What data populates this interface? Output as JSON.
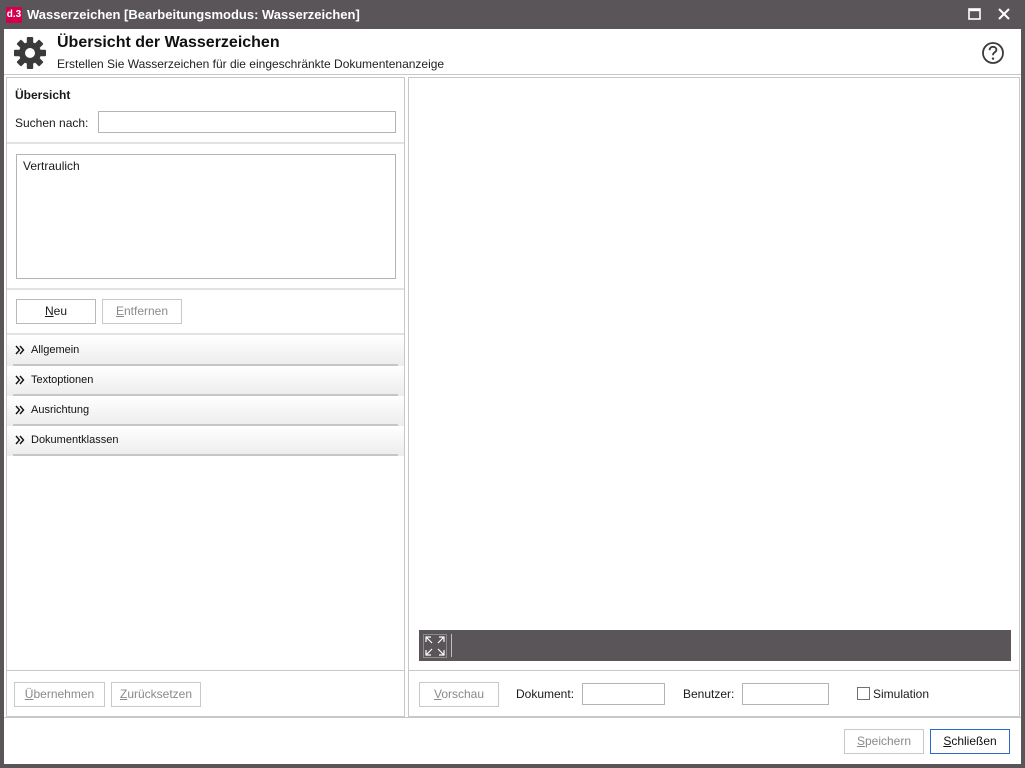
{
  "titlebar": {
    "logo_text": "d.3",
    "title": "Wasserzeichen [Bearbeitungsmodus: Wasserzeichen]",
    "icons": {
      "maximize": "maximize-icon",
      "close": "close-icon"
    }
  },
  "header": {
    "title": "Übersicht der Wasserzeichen",
    "subtitle": "Erstellen Sie Wasserzeichen für die eingeschränkte Dokumentenanzeige",
    "icon": "gear-icon",
    "help_icon": "help-icon"
  },
  "overview": {
    "title": "Übersicht",
    "search_label": "Suchen nach:",
    "search_value": "",
    "items": [
      "Vertraulich"
    ]
  },
  "list_buttons": {
    "new": {
      "u": "N",
      "rest": "eu"
    },
    "remove": {
      "u": "E",
      "rest": "ntfernen"
    }
  },
  "accordion": [
    {
      "label": "Allgemein"
    },
    {
      "label": "Textoptionen"
    },
    {
      "label": "Ausrichtung"
    },
    {
      "label": "Dokumentklassen"
    }
  ],
  "left_actions": {
    "apply": {
      "u": "Ü",
      "rest": "bernehmen"
    },
    "reset": {
      "u": "Z",
      "rest": "urücksetzen"
    }
  },
  "preview": {
    "button": {
      "u": "V",
      "rest": "orschau"
    },
    "document_label": "Dokument:",
    "document_value": "",
    "user_label": "Benutzer:",
    "user_value": "",
    "simulation_label": "Simulation",
    "simulation_checked": false,
    "expand_icon": "fullscreen-icon"
  },
  "footer": {
    "save": {
      "u": "S",
      "rest": "peichern"
    },
    "close": {
      "u": "S",
      "rest": "chließen"
    }
  },
  "colors": {
    "titlebar": "#595559",
    "logo": "#d4004e",
    "primary_border": "#2b6ad1"
  }
}
